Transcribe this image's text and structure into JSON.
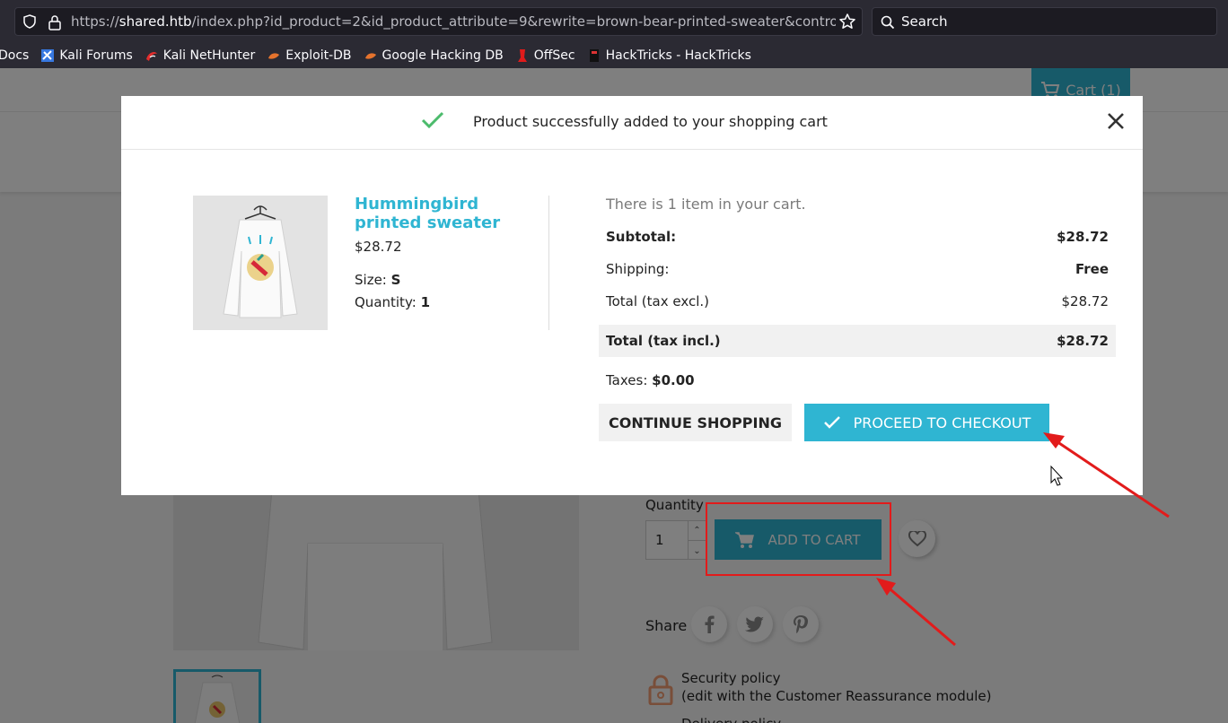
{
  "browser": {
    "url_prefix": "https://",
    "url_host": "shared.htb",
    "url_path": "/index.php?id_product=2&id_product_attribute=9&rewrite=brown-bear-printed-sweater&controller=prod",
    "search_placeholder": "Search",
    "bookmarks": [
      {
        "label": "Docs",
        "icon": "docs-icon"
      },
      {
        "label": "Kali Forums",
        "icon": "kali-forums-icon"
      },
      {
        "label": "Kali NetHunter",
        "icon": "kali-nethunter-icon"
      },
      {
        "label": "Exploit-DB",
        "icon": "exploit-db-icon"
      },
      {
        "label": "Google Hacking DB",
        "icon": "ghdb-icon"
      },
      {
        "label": "OffSec",
        "icon": "offsec-icon"
      },
      {
        "label": "HackTricks - HackTricks",
        "icon": "hacktricks-icon"
      }
    ]
  },
  "page": {
    "cart_label": "Cart (1)",
    "quantity_label": "Quantity",
    "quantity_value": "1",
    "add_to_cart": "ADD TO CART",
    "share_label": "Share",
    "reassurance_title": "Security policy",
    "reassurance_sub": "(edit with the Customer Reassurance module)",
    "reassurance_next": "Delivery policy"
  },
  "modal": {
    "title": "Product successfully added to your shopping cart",
    "product_name": "Hummingbird printed sweater",
    "product_price": "$28.72",
    "size_label": "Size:",
    "size_value": "S",
    "quantity_label": "Quantity:",
    "quantity_value": "1",
    "cart_count_text": "There is 1 item in your cart.",
    "summary": [
      {
        "label": "Subtotal:",
        "value": "$28.72"
      },
      {
        "label": "Shipping:",
        "value": "Free"
      },
      {
        "label": "Total (tax excl.)",
        "value": "$28.72"
      },
      {
        "label": "Total (tax incl.)",
        "value": "$28.72"
      }
    ],
    "taxes_label": "Taxes:",
    "taxes_value": "$0.00",
    "continue_label": "CONTINUE SHOPPING",
    "checkout_label": "PROCEED TO CHECKOUT"
  },
  "colors": {
    "accent": "#2fb5d2",
    "success": "#4cbb6c",
    "annotation": "#e21b1b"
  }
}
